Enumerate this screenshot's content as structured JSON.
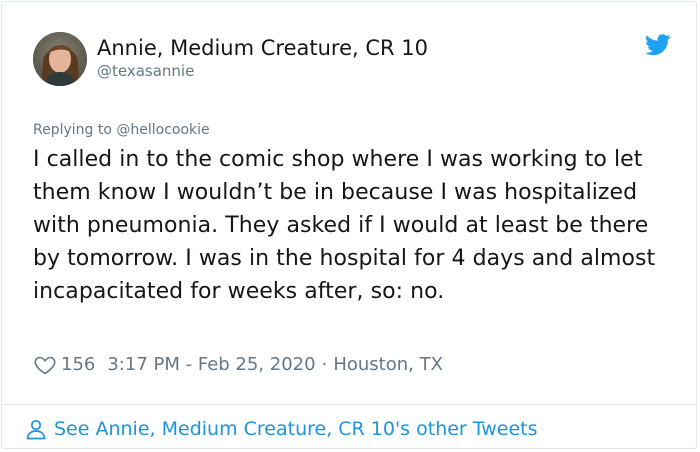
{
  "tweet": {
    "author_name": "Annie, Medium Creature, CR 10",
    "author_handle": "@texasannie",
    "replying_prefix": "Replying to",
    "replying_to": "@hellocookie",
    "text": "I called in to the comic shop where I was working to let them know I wouldn’t be in because I was hospitalized with pneumonia. They asked if I would at least be there by tomorrow. I was in the hospital for 4 days and almost incapacitated for weeks after, so: no.",
    "likes": "156",
    "timestamp": "3:17 PM - Feb 25, 2020",
    "separator": "·",
    "location": "Houston, TX"
  },
  "footer": {
    "see_more": "See Annie, Medium Creature, CR 10's other Tweets"
  },
  "icons": {
    "bird": "twitter-bird-icon",
    "heart": "heart-outline-icon",
    "person": "person-outline-icon"
  },
  "colors": {
    "brand_blue": "#1da1f2",
    "link_blue": "#1b95e0",
    "muted_gray": "#657786",
    "text": "#14171a",
    "border": "#e1e8ed"
  }
}
